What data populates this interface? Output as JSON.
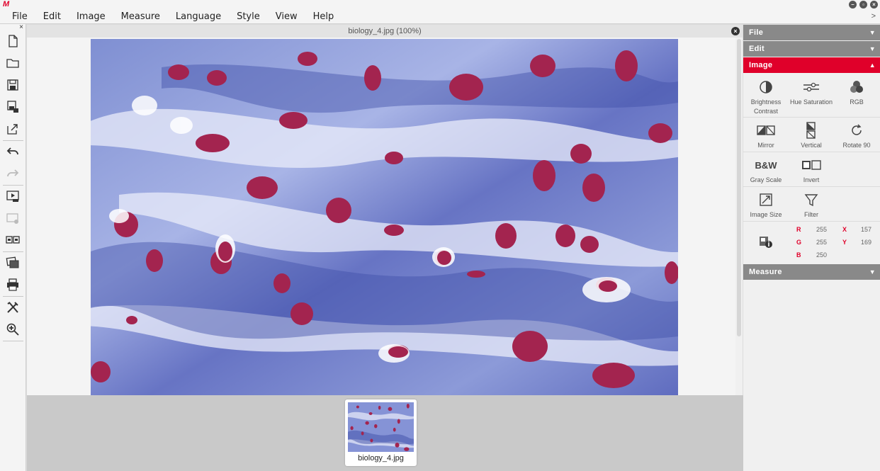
{
  "app": {
    "logo": "M"
  },
  "window_controls": [
    "–",
    "▫",
    "×"
  ],
  "menu": {
    "items": [
      "File",
      "Edit",
      "Image",
      "Measure",
      "Language",
      "Style",
      "View",
      "Help"
    ],
    "right_chevron": ">"
  },
  "toolbar": {
    "close": "×",
    "tools": [
      "new-file-icon",
      "open-folder-icon",
      "save-icon",
      "save-as-icon",
      "export-icon",
      "undo-icon",
      "redo-icon",
      "slideshow-icon",
      "camera-icon",
      "compare-icon",
      "gallery-icon",
      "print-icon",
      "tools-icon",
      "zoom-icon"
    ]
  },
  "document": {
    "title": "biology_4.jpg (100%)",
    "close": "×"
  },
  "thumbnail": {
    "label": "biology_4.jpg"
  },
  "panel": {
    "sections": {
      "file": {
        "label": "File",
        "arrow": "▼"
      },
      "edit": {
        "label": "Edit",
        "arrow": "▼"
      },
      "image": {
        "label": "Image",
        "arrow": "▲"
      },
      "measure": {
        "label": "Measure",
        "arrow": "▼"
      }
    },
    "image_tools": [
      {
        "id": "brightness",
        "label": "Brightness Contrast",
        "icon": "brightness-contrast-icon"
      },
      {
        "id": "hue",
        "label": "Hue Saturation",
        "icon": "hue-saturation-icon"
      },
      {
        "id": "rgb",
        "label": "RGB",
        "icon": "rgb-icon"
      },
      {
        "id": "mirror",
        "label": "Mirror",
        "icon": "mirror-icon"
      },
      {
        "id": "vertical",
        "label": "Vertical",
        "icon": "vertical-flip-icon"
      },
      {
        "id": "rotate",
        "label": "Rotate 90",
        "icon": "rotate-icon"
      },
      {
        "id": "grayscale",
        "label": "Gray Scale",
        "icon": "bw-icon",
        "glyph": "B&W"
      },
      {
        "id": "invert",
        "label": "Invert",
        "icon": "invert-icon"
      },
      {
        "id": "imagesize",
        "label": "Image Size",
        "icon": "image-size-icon"
      },
      {
        "id": "filter",
        "label": "Filter",
        "icon": "filter-icon"
      }
    ],
    "pixel_info": {
      "r_label": "R",
      "r": "255",
      "g_label": "G",
      "g": "255",
      "b_label": "B",
      "b": "250",
      "x_label": "X",
      "x": "157",
      "y_label": "Y",
      "y": "169"
    }
  },
  "colors": {
    "accent": "#e0002a",
    "section_header": "#898989",
    "panel_bg": "#f0f0f0"
  }
}
